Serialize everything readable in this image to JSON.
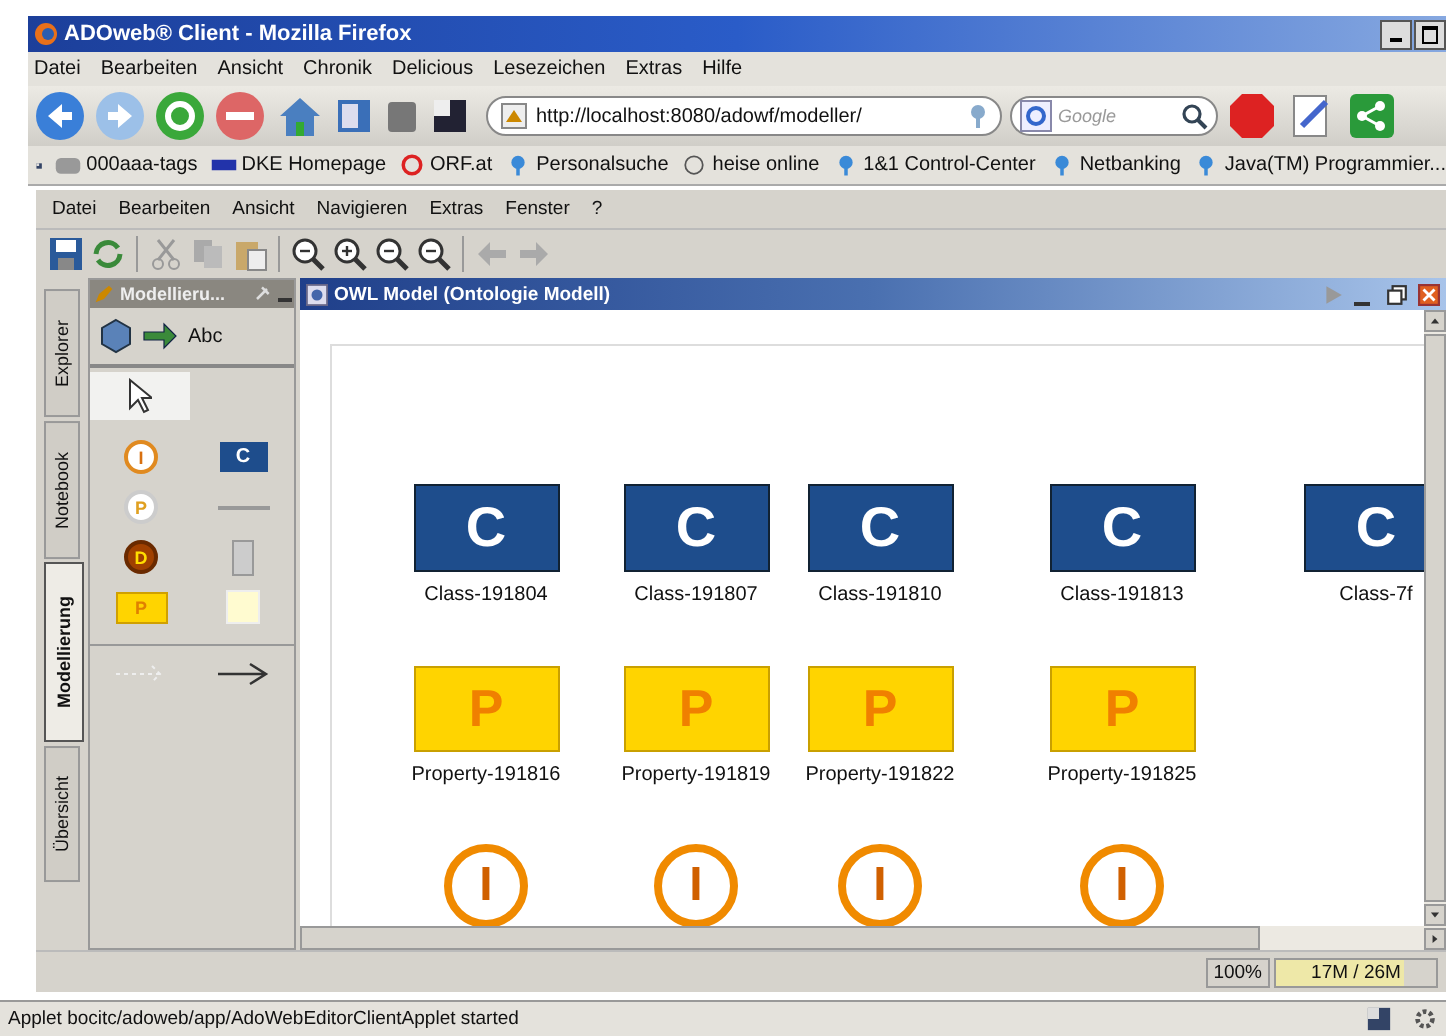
{
  "window": {
    "title": "ADOweb® Client - Mozilla Firefox"
  },
  "menu": [
    "Datei",
    "Bearbeiten",
    "Ansicht",
    "Chronik",
    "Delicious",
    "Lesezeichen",
    "Extras",
    "Hilfe"
  ],
  "address": {
    "value": "http://localhost:8080/adowf/modeller/"
  },
  "search": {
    "placeholder": "Google"
  },
  "bookmarks": [
    {
      "label": "000aaa-tags",
      "kind": "folder"
    },
    {
      "label": "DKE Homepage",
      "kind": "dke"
    },
    {
      "label": "ORF.at",
      "kind": "orf"
    },
    {
      "label": "Personalsuche",
      "kind": "pin"
    },
    {
      "label": "heise online",
      "kind": "heise"
    },
    {
      "label": "1&1 Control-Center",
      "kind": "pin"
    },
    {
      "label": "Netbanking",
      "kind": "pin"
    },
    {
      "label": "Java(TM) Programmier...",
      "kind": "pin"
    }
  ],
  "applet_menu": [
    "Datei",
    "Bearbeiten",
    "Ansicht",
    "Navigieren",
    "Extras",
    "Fenster",
    "?"
  ],
  "side_tabs": [
    {
      "label": "Explorer",
      "selected": false
    },
    {
      "label": "Notebook",
      "selected": false
    },
    {
      "label": "Modellierung",
      "selected": true
    },
    {
      "label": "Übersicht",
      "selected": false
    }
  ],
  "palette": {
    "title": "Modellieru...",
    "text_tool": "Abc",
    "tools": [
      {
        "kind": "instance",
        "letter": "I"
      },
      {
        "kind": "class",
        "letter": "C"
      },
      {
        "kind": "property-ring",
        "letter": "P"
      },
      {
        "kind": "tiny"
      },
      {
        "kind": "datatype",
        "letter": "D"
      },
      {
        "kind": "block"
      },
      {
        "kind": "property",
        "letter": "P"
      },
      {
        "kind": "note"
      }
    ]
  },
  "model_window": {
    "title": "OWL Model (Ontologie Modell)"
  },
  "diagram": {
    "rows": [
      {
        "kind": "class",
        "nodes": [
          {
            "letter": "C",
            "label": "Class-191804"
          },
          {
            "letter": "C",
            "label": "Class-191807"
          },
          {
            "letter": "C",
            "label": "Class-191810"
          },
          {
            "letter": "C",
            "label": "Class-191813"
          },
          {
            "letter": "C",
            "label": "Class-7f"
          }
        ]
      },
      {
        "kind": "property",
        "nodes": [
          {
            "letter": "P",
            "label": "Property-191816"
          },
          {
            "letter": "P",
            "label": "Property-191819"
          },
          {
            "letter": "P",
            "label": "Property-191822"
          },
          {
            "letter": "P",
            "label": "Property-191825"
          }
        ]
      },
      {
        "kind": "instance",
        "nodes": [
          {
            "letter": "I"
          },
          {
            "letter": "I"
          },
          {
            "letter": "I"
          },
          {
            "letter": "I"
          }
        ]
      }
    ]
  },
  "zoom": "100%",
  "memory": {
    "reading": "17M / 26M",
    "level": 0.8
  },
  "status_bar": "Applet bocitc/adoweb/app/AdoWebEditorClientApplet started"
}
